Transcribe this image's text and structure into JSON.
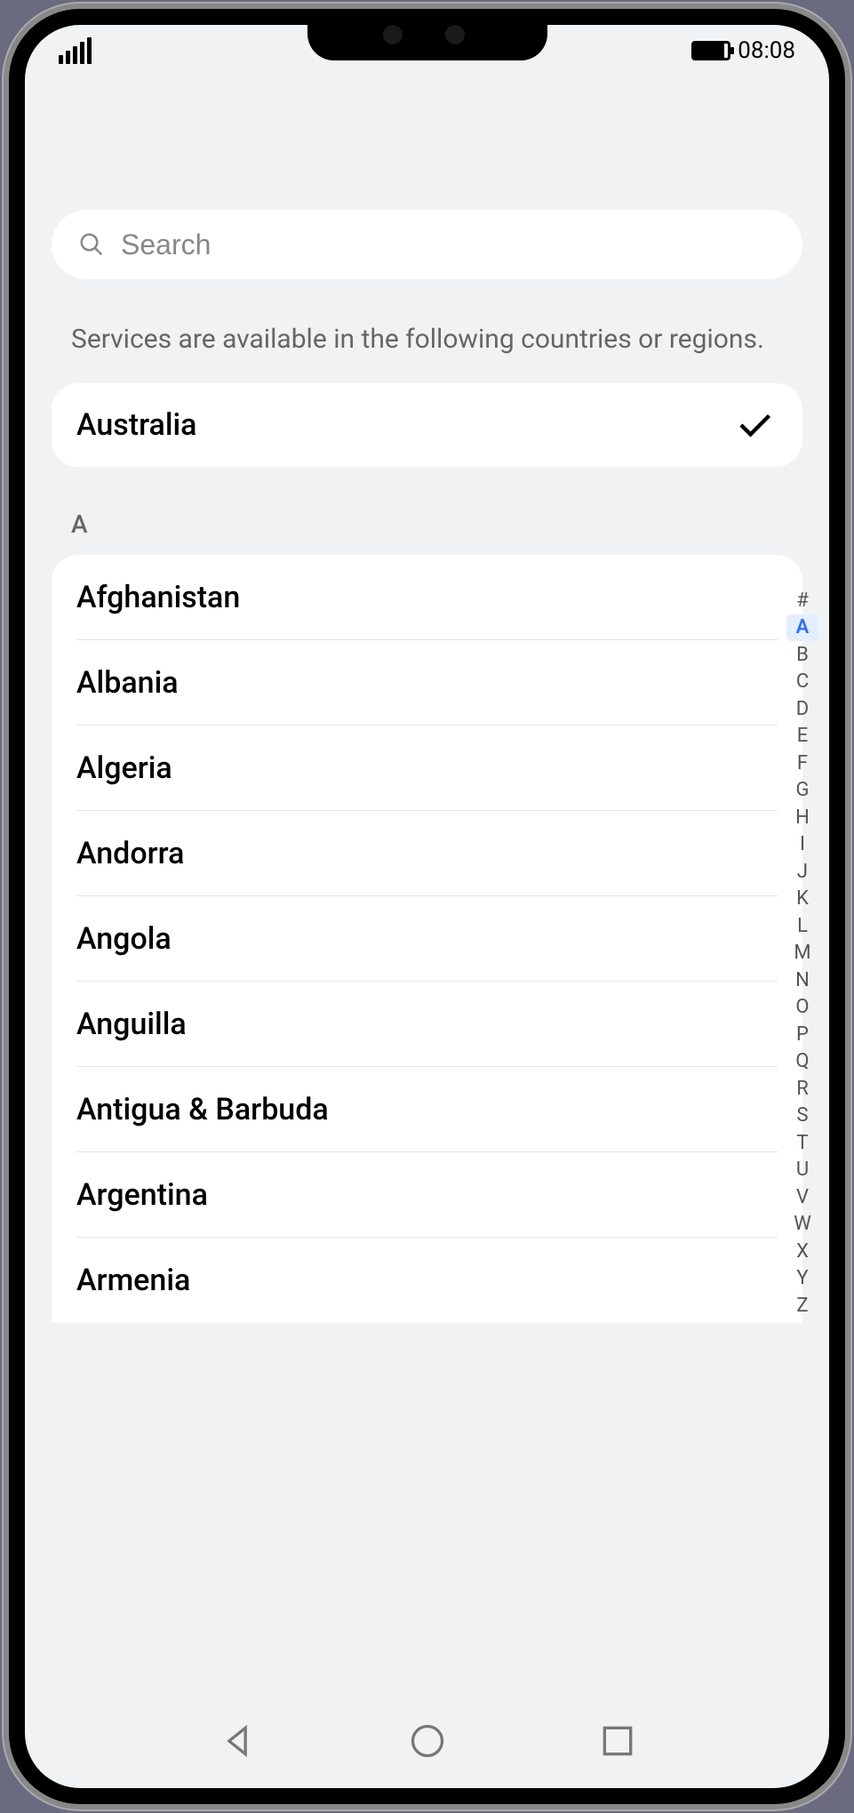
{
  "status_bar": {
    "time": "08:08"
  },
  "search": {
    "placeholder": "Search"
  },
  "info_text": "Services are available in the following countries or regions.",
  "selected": {
    "label": "Australia"
  },
  "section": {
    "header": "A"
  },
  "countries": [
    {
      "label": "Afghanistan"
    },
    {
      "label": "Albania"
    },
    {
      "label": "Algeria"
    },
    {
      "label": "Andorra"
    },
    {
      "label": "Angola"
    },
    {
      "label": "Anguilla"
    },
    {
      "label": "Antigua & Barbuda"
    },
    {
      "label": "Argentina"
    },
    {
      "label": "Armenia"
    }
  ],
  "alpha_index": {
    "active": "A",
    "letters": [
      "#",
      "A",
      "B",
      "C",
      "D",
      "E",
      "F",
      "G",
      "H",
      "I",
      "J",
      "K",
      "L",
      "M",
      "N",
      "O",
      "P",
      "Q",
      "R",
      "S",
      "T",
      "U",
      "V",
      "W",
      "X",
      "Y",
      "Z"
    ]
  }
}
